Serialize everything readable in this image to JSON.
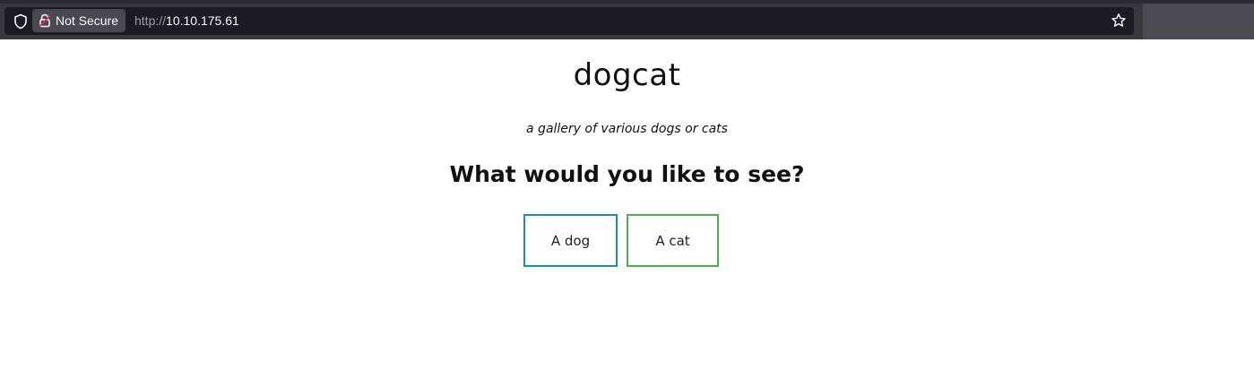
{
  "browser": {
    "security_label": "Not Secure",
    "url_scheme": "http://",
    "url_host": "10.10.175.61"
  },
  "page": {
    "title": "dogcat",
    "subtitle": "a gallery of various dogs or cats",
    "question": "What would you like to see?",
    "choices": [
      {
        "label": "A dog",
        "border_color": "#1f8aad"
      },
      {
        "label": "A cat",
        "border_color": "#4caf50"
      }
    ]
  },
  "icons": [
    "shield-icon",
    "lock-icon",
    "star-icon"
  ]
}
